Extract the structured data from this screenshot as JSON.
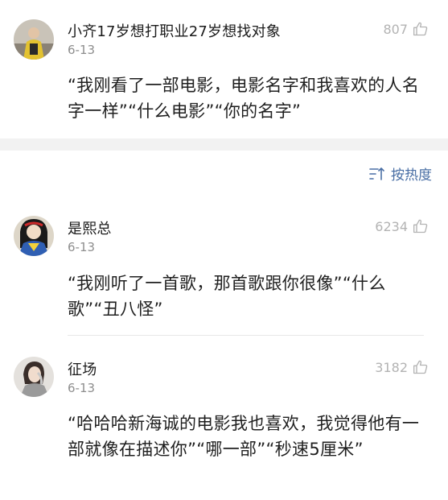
{
  "comments": [
    {
      "username": "小齐17岁想打职业27岁想找对象",
      "date": "6-13",
      "likes": "807",
      "text": "“我刚看了一部电影，电影名字和我喜欢的人名字一样”“什么电影”“你的名字”"
    },
    {
      "username": "是熙总",
      "date": "6-13",
      "likes": "6234",
      "text": "“我刚听了一首歌，那首歌跟你很像”“什么歌”“丑八怪”"
    },
    {
      "username": "征场",
      "date": "6-13",
      "likes": "3182",
      "text": "“哈哈哈新海诚的电影我也喜欢，我觉得他有一部就像在描述你”“哪一部”“秒速5厘米”"
    }
  ],
  "sort": {
    "label": "按热度",
    "icon": "sort-icon"
  },
  "icons": {
    "like": "thumbs-up-icon"
  },
  "colors": {
    "accent": "#4a6fa5",
    "muted": "#b3b3b3"
  }
}
